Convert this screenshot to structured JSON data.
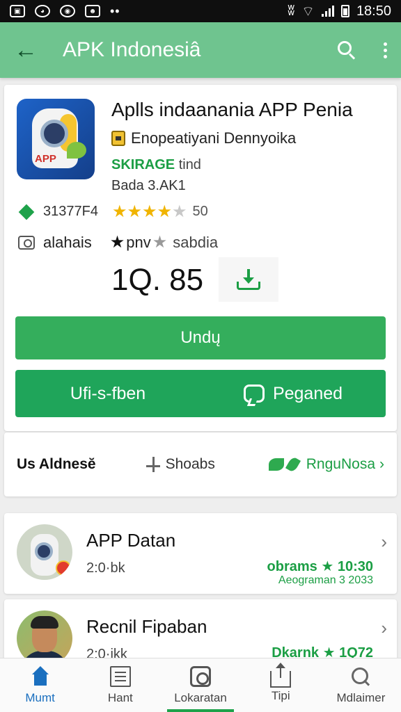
{
  "status_bar": {
    "time": "18:50"
  },
  "app_bar": {
    "back_glyph": "←",
    "title": "APK Indonesiâ"
  },
  "app": {
    "name": "Aplls indaanania APP Penia",
    "developer": "Enopeatiyani Dennyoika",
    "category_green": "SKIRAGE",
    "category_gray": "tind",
    "version": "Bada 3.AK1",
    "downloads": "31377F4",
    "rating_stars": 4,
    "rating_count": "50",
    "cam_label": "alahais",
    "age_text": "pnv",
    "age_sub": "sabdia",
    "size": "1Q. 85"
  },
  "buttons": {
    "primary": "Undų",
    "secondary_left": "Ufi-s-fben",
    "secondary_right": "Peganed"
  },
  "stats": {
    "left": "Us Aldnesĕ",
    "mid": "Shoabs",
    "right": "RnguNosa"
  },
  "list": [
    {
      "title": "APP Datan",
      "sub": "2:0·bk",
      "right1": "obrams ★ 10:30",
      "right2": "Aeograman 3 2033",
      "chevron": "›"
    },
    {
      "title": "Recnil Fipaban",
      "sub": "2:0·ikk",
      "right1": "Dkarnk ★ 1Q72",
      "right2": "",
      "chevron": "›"
    }
  ],
  "bottom_nav": [
    {
      "label": "Mumt",
      "icon": "home-icon"
    },
    {
      "label": "Hant",
      "icon": "document-icon"
    },
    {
      "label": "Lokaratan",
      "icon": "camera-icon"
    },
    {
      "label": "Tipi",
      "icon": "share-icon"
    },
    {
      "label": "Mdlaimer",
      "icon": "search-icon"
    }
  ],
  "colors": {
    "app_bar": "#6fc48f",
    "primary_button": "#34ae5c",
    "secondary_button": "#1fa55a",
    "accent_green": "#1b9e44",
    "nav_active": "#1a6fbf",
    "star": "#f0b400"
  }
}
